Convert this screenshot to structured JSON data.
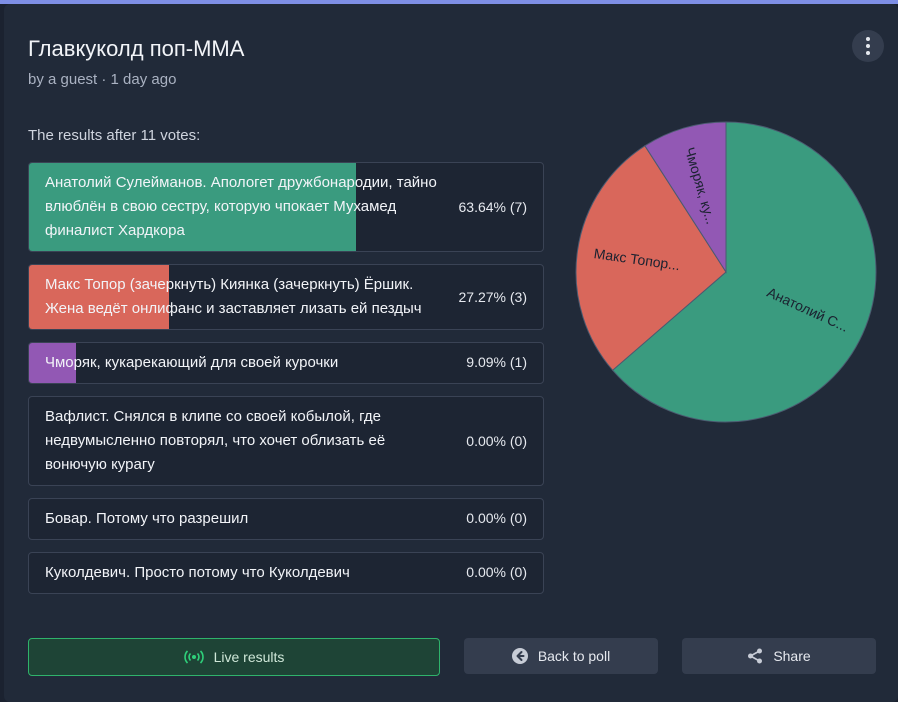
{
  "poll": {
    "title": "Главкуколд поп-ММА",
    "meta": "by a guest · 1 day ago",
    "results_label": "The results after 11 votes:"
  },
  "colors": {
    "green": "#3a9b7f",
    "red": "#d9675b",
    "purple": "#9258b4"
  },
  "options": [
    {
      "text": "Анатолий Сулейманов. Апологет дружбонародии, тайно влюблён в свою сестру, которую чпокает Мухамед финалист Хардкора",
      "result": "63.64% (7)",
      "share": 0.6364,
      "color": "#3a9b7f"
    },
    {
      "text": "Макс Топор (зачеркнуть) Киянка (зачеркнуть) Ёршик. Жена ведёт онлифанс и заставляет лизать ей пездыч",
      "result": "27.27% (3)",
      "share": 0.2727,
      "color": "#d9675b"
    },
    {
      "text": "Чморяк, кукарекающий для своей курочки",
      "result": "9.09% (1)",
      "share": 0.0909,
      "color": "#9258b4"
    },
    {
      "text": "Вафлист. Снялся в клипе со своей кобылой, где недвумысленно повторял, что хочет облизать её вонючую курагу",
      "result": "0.00% (0)",
      "share": 0,
      "color": "#3a9b7f"
    },
    {
      "text": "Бовар. Потому что разрешил",
      "result": "0.00% (0)",
      "share": 0,
      "color": "#3a9b7f"
    },
    {
      "text": "Куколдевич. Просто потому что Куколдевич",
      "result": "0.00% (0)",
      "share": 0,
      "color": "#3a9b7f"
    }
  ],
  "chart_data": {
    "type": "pie",
    "slices": [
      {
        "label": "Анатолий С...",
        "value": 7,
        "color": "#3a9b7f"
      },
      {
        "label": "Макс Топор...",
        "value": 3,
        "color": "#d9675b"
      },
      {
        "label": "Чморяк, ку...",
        "value": 1,
        "color": "#9258b4"
      }
    ]
  },
  "actions": {
    "live": "Live results",
    "back": "Back to poll",
    "share": "Share"
  },
  "icons": {
    "menu": "vertical-dots-icon",
    "live": "broadcast-icon",
    "back": "arrow-left-circle-icon",
    "share": "share-icon"
  }
}
